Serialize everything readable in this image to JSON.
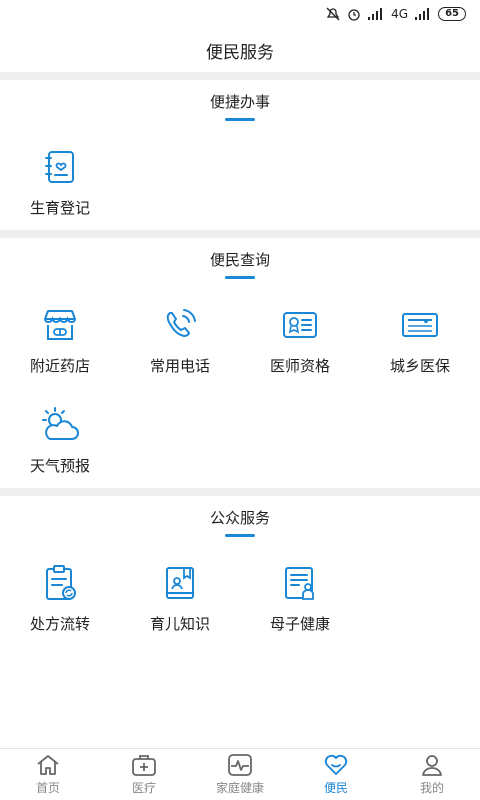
{
  "status_bar": {
    "network": "4G",
    "battery": "65"
  },
  "page": {
    "title": "便民服务"
  },
  "colors": {
    "accent": "#1a86d6",
    "divider": "#eeeeee"
  },
  "sections": [
    {
      "title": "便捷办事",
      "items": [
        {
          "label": "生育登记",
          "icon": "birth-register-icon"
        }
      ]
    },
    {
      "title": "便民查询",
      "items": [
        {
          "label": "附近药店",
          "icon": "pharmacy-icon"
        },
        {
          "label": "常用电话",
          "icon": "phone-icon"
        },
        {
          "label": "医师资格",
          "icon": "doctor-license-icon"
        },
        {
          "label": "城乡医保",
          "icon": "insurance-card-icon"
        },
        {
          "label": "天气预报",
          "icon": "weather-icon"
        }
      ]
    },
    {
      "title": "公众服务",
      "items": [
        {
          "label": "处方流转",
          "icon": "prescription-icon"
        },
        {
          "label": "育儿知识",
          "icon": "parenting-book-icon"
        },
        {
          "label": "母子健康",
          "icon": "mother-child-icon"
        }
      ]
    }
  ],
  "tabbar": [
    {
      "label": "首页",
      "icon": "home-icon",
      "active": false
    },
    {
      "label": "医疗",
      "icon": "medical-kit-icon",
      "active": false
    },
    {
      "label": "家庭健康",
      "icon": "heartbeat-icon",
      "active": false
    },
    {
      "label": "便民",
      "icon": "heart-icon",
      "active": true
    },
    {
      "label": "我的",
      "icon": "user-icon",
      "active": false
    }
  ]
}
